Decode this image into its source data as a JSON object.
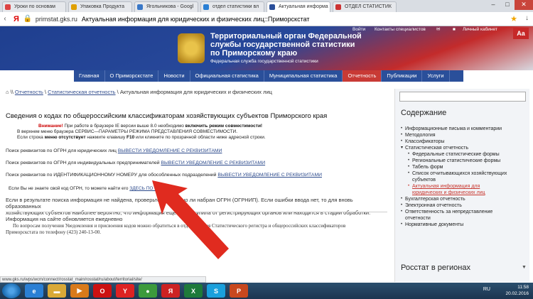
{
  "browser": {
    "tabs": [
      {
        "label": "Уроки по основам",
        "fav_color": "#d44"
      },
      {
        "label": "Упаковка Продукта",
        "fav_color": "#e0a000"
      },
      {
        "label": "Ягольникова - Googl",
        "fav_color": "#3a78c7"
      },
      {
        "label": "отдел статистики вл",
        "fav_color": "#2a7fd4"
      },
      {
        "label": "Актуальная информа",
        "fav_color": "#2a4f9a"
      },
      {
        "label": "ОТДЕЛ СТАТИСТИК",
        "fav_color": "#c33"
      }
    ],
    "url": "primstat.gks.ru",
    "page_title": "Актуальная информация для юридических и физических лиц::Приморскстат",
    "ya": "Я"
  },
  "site": {
    "top_links": [
      "Войти",
      "Контакты специалистов",
      "Личный кабинет"
    ],
    "title_lines": [
      "Территориальный орган Федеральной",
      "службы государственной статистики",
      "по Приморскому краю"
    ],
    "subtitle": "Федеральная служба государственной статистики",
    "accessibility": "Aa",
    "menu": [
      "Главная",
      "О Приморскстате",
      "Новости",
      "Официальная статистика",
      "Муниципальная статистика",
      "Отчетность",
      "Публикации",
      "Услуги"
    ],
    "menu_active_index": 5
  },
  "content": {
    "breadcrumb": [
      "Отчетность",
      "Статистическая отчетность",
      "Актуальная информация для юридических и физических лиц"
    ],
    "heading": "Сведения о кодах по общероссийским классификаторам хозяйствующих субъектов Приморского края",
    "warn_label": "Внимание!",
    "warn_line1": "При работе в браузере IE версии выше 8.0 необходимо",
    "warn_bold": "включить режим совместимости!",
    "warn_line2": "В верхнем меню браузера СЕРВИС—ПАРАМЕТРЫ РЕЖИМА ПРЕДСТАВЛЕНИЯ СОВМЕСТИМОСТИ.",
    "warn_line3a": "Если строка",
    "warn_line3b": "меню отсутствует",
    "warn_line3c": "нажмите клавишу",
    "warn_line3d": "F10",
    "warn_line3e": "или кликните по прозрачной области ниже адресной строки.",
    "search_lines": [
      {
        "text": "Поиск реквизитов по ОГРН для юридических лиц",
        "link": "ВЫВЕСТИ УВЕДОМЛЕНИЕ С РЕКВИЗИТАМИ"
      },
      {
        "text": "Поиск реквизитов по ОГРН для индивидуальных предпринимателей",
        "link": "ВЫВЕСТИ УВЕДОМЛЕНИЕ С РЕКВИЗИТАМИ"
      },
      {
        "text": "Поиск реквизитов по ИДЕНТИФИКАЦИОННОМУ НОМЕРУ для обособленных подразделений",
        "link": "ВЫВЕСТИ УВЕДОМЛЕНИЕ С РЕКВИЗИТАМИ"
      }
    ],
    "inn_text": "Если Вы не знаете свой код ОГРН, то можете найти его",
    "inn_link": "ЗДЕСЬ ПО ИНН",
    "para_line1": "Если в результате поиска информация не найдена, проверьте правильно ли набран ОГРН (ОГРНИП). Если ошибки ввода нет, то для вновь образованных",
    "para_line2": "хозяйствующих субъектов наиболее вероятно, что информация еще не поступила от регистрирующих органов или находится в стадии обработки.",
    "para_line3": "Информация на сайте обновляется ежедневно",
    "para2_line1": "По вопросам получения Уведомления и присвоения кодов можно обратиться в отдел ведения Статистического регистра и общероссийских классификаторов",
    "para2_line2": "Приморскстата по телефону (423) 240-13-00."
  },
  "sidebar": {
    "heading": "Содержание",
    "items": [
      {
        "label": "Информационные письма и комментарии",
        "level": 0,
        "bullet": "•"
      },
      {
        "label": "Методология",
        "level": 0,
        "bullet": "•"
      },
      {
        "label": "Классификаторы",
        "level": 0,
        "bullet": "•"
      },
      {
        "label": "Статистическая отчетность",
        "level": 0,
        "bullet": "▾"
      },
      {
        "label": "Федеральные статистические формы",
        "level": 1,
        "bullet": "•"
      },
      {
        "label": "Региональные статистические формы",
        "level": 1,
        "bullet": "•"
      },
      {
        "label": "Табель форм",
        "level": 1,
        "bullet": "•"
      },
      {
        "label": "Список отчитывающихся хозяйствующих",
        "level": 1,
        "bullet": "•"
      },
      {
        "label": "субъектов",
        "level": 1,
        "bullet": ""
      },
      {
        "label": "Актуальная информация для",
        "level": 1,
        "bullet": "•",
        "active": true
      },
      {
        "label": "юридических и физических лиц",
        "level": 1,
        "bullet": "",
        "active": true
      },
      {
        "label": "Бухгалтерская отчетность",
        "level": 0,
        "bullet": "•"
      },
      {
        "label": "Электронная отчетность",
        "level": 0,
        "bullet": "•"
      },
      {
        "label": "Ответственность за непредставление",
        "level": 0,
        "bullet": "•"
      },
      {
        "label": "отчетности",
        "level": 0,
        "bullet": ""
      },
      {
        "label": "Нормативные документы",
        "level": 0,
        "bullet": "•"
      }
    ],
    "regions_heading": "Росстат в регионах"
  },
  "status_bar": "www.gks.ru/wps/wcm/connect/rosstat_main/rosstat/ru/about/territorial/site/",
  "taskbar": {
    "apps": [
      {
        "name": "ie",
        "glyph": "e",
        "color": "#2a7fd4"
      },
      {
        "name": "explorer",
        "glyph": "▬",
        "color": "#d9a937"
      },
      {
        "name": "media",
        "glyph": "▶",
        "color": "#d97a1a"
      },
      {
        "name": "opera",
        "glyph": "O",
        "color": "#c11"
      },
      {
        "name": "yandex",
        "glyph": "Y",
        "color": "#d22"
      },
      {
        "name": "chrome",
        "glyph": "●",
        "color": "#3c9a3c"
      },
      {
        "name": "yandex-browser",
        "glyph": "Я",
        "color": "#c22"
      },
      {
        "name": "excel",
        "glyph": "X",
        "color": "#1e7a3a"
      },
      {
        "name": "skype",
        "glyph": "S",
        "color": "#1aa0dc"
      },
      {
        "name": "powerpoint",
        "glyph": "P",
        "color": "#c8481e"
      }
    ],
    "lang": "RU",
    "time": "11:58",
    "date": "20.02.2016"
  }
}
